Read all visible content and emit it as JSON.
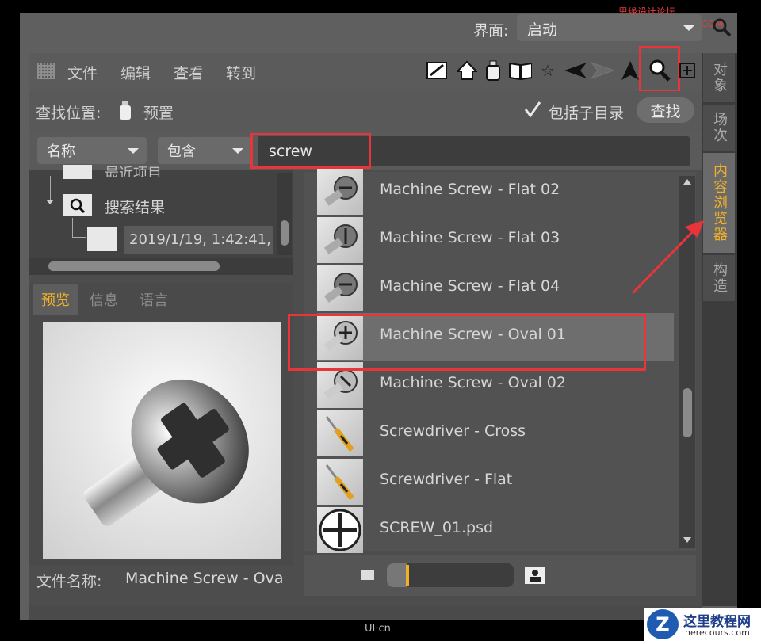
{
  "watermark_top": "思缘设计论坛 WWW.MISSYUAN.COM",
  "interface": {
    "label": "界面:",
    "value": "启动"
  },
  "menu": [
    "文件",
    "编辑",
    "查看",
    "转到"
  ],
  "toolbar_icons": [
    "draw-icon",
    "home-icon",
    "bottle-icon",
    "book-icon",
    "star-icon",
    "back-icon",
    "forward-icon",
    "cursor-icon",
    "search-icon",
    "add-icon"
  ],
  "search": {
    "location_label": "查找位置:",
    "location_value": "预置",
    "include_subdirs": "包括子目录",
    "find_button": "查找",
    "include_subdirs_checked": true
  },
  "filter": {
    "field": "名称",
    "mode": "包含",
    "query": "screw"
  },
  "tree": {
    "partial_item": "最近项目",
    "search_results": "搜索结果",
    "result_item": "2019/1/19, 1:42:41,"
  },
  "tabs": [
    "预览",
    "信息",
    "语言"
  ],
  "active_tab": "预览",
  "file_name": {
    "label": "文件名称:",
    "value": "Machine Screw - Ova"
  },
  "items": [
    {
      "name": "Machine Screw - Flat 02",
      "icon": "screw-flat-icon"
    },
    {
      "name": "Machine Screw - Flat 03",
      "icon": "screw-flat-icon"
    },
    {
      "name": "Machine Screw - Flat 04",
      "icon": "screw-flat-icon"
    },
    {
      "name": "Machine Screw - Oval 01",
      "icon": "screw-oval-icon",
      "selected": true
    },
    {
      "name": "Machine Screw - Oval 02",
      "icon": "screw-oval-icon"
    },
    {
      "name": "Screwdriver - Cross",
      "icon": "screwdriver-icon"
    },
    {
      "name": "Screwdriver - Flat",
      "icon": "screwdriver-icon"
    },
    {
      "name": "SCREW_01.psd",
      "icon": "cross-circle-icon"
    }
  ],
  "side_tabs": [
    "对象",
    "场次",
    "内容浏览器",
    "构造"
  ],
  "active_side_tab": "内容浏览器",
  "colors": {
    "accent": "#f0b02a",
    "highlight": "#e8343a"
  },
  "footer_logo": "UI·cn",
  "brand": {
    "name": "这里教程网",
    "url": "herecours.com",
    "letter": "Z"
  }
}
